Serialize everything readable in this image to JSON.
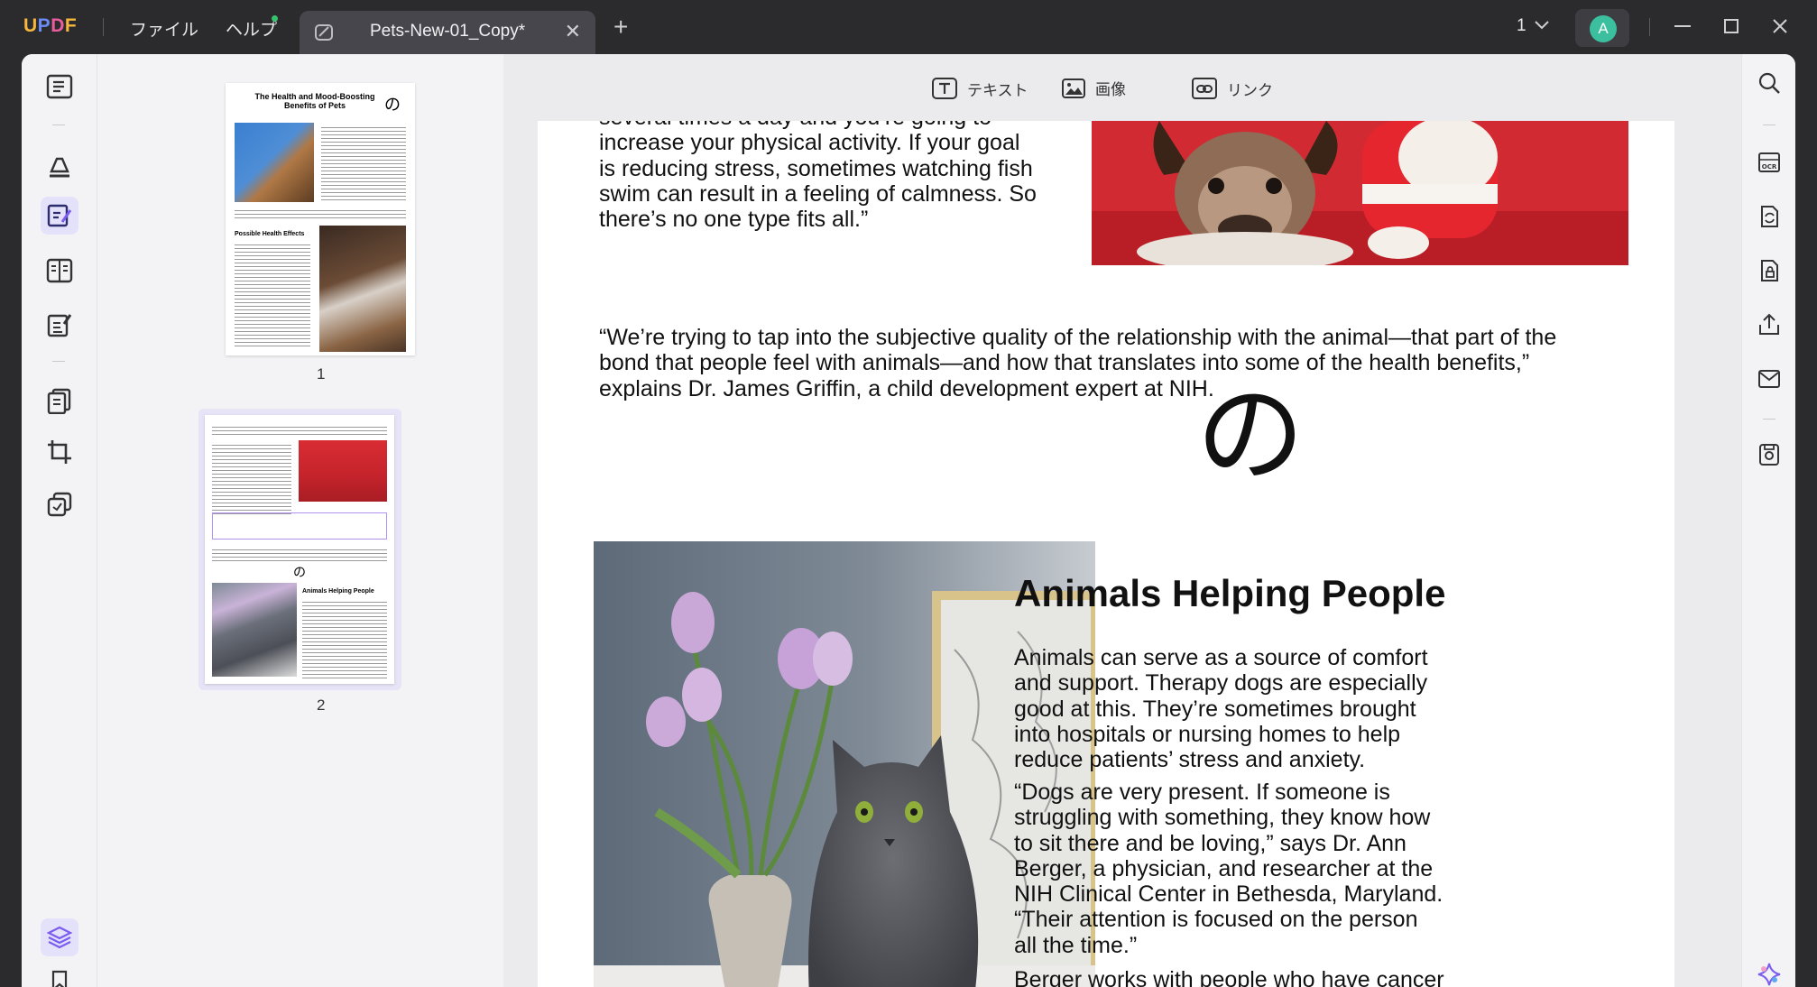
{
  "app": {
    "logo": "UPDF"
  },
  "menu": {
    "file": "ファイル",
    "help": "ヘルプ"
  },
  "tab": {
    "title": "Pets-New-01_Copy*"
  },
  "page_selector": {
    "value": "1"
  },
  "user": {
    "initial": "A"
  },
  "toolbar": {
    "text": "テキスト",
    "image": "画像",
    "link": "リンク"
  },
  "thumbnails": [
    {
      "number": "1",
      "title": "The Health and Mood-Boosting Benefits of Pets",
      "glyph": "の",
      "section": "Possible Health Effects"
    },
    {
      "number": "2",
      "glyph": "の",
      "section": "Animals Helping People"
    }
  ],
  "document": {
    "para1_lines": [
      "several times a day and you’re going to",
      "increase your physical activity.  If your goal",
      "is reducing stress, sometimes watching fish",
      "swim can result in a feeling of calmness. So",
      "there’s no one type fits all.”"
    ],
    "quote_lines": [
      "“We’re trying to tap into the subjective quality of the relationship with the animal—that part of the",
      "bond that people feel with animals—and how that translates into some of the health benefits,”",
      "explains Dr. James Griffin, a child development expert at NIH."
    ],
    "glyph": "の",
    "heading": "Animals Helping People",
    "para2_lines": [
      "Animals can serve as a source of comfort",
      "and support. Therapy dogs are especially",
      "good at this. They’re sometimes brought",
      "into hospitals or nursing homes to help",
      "reduce patients’ stress and anxiety."
    ],
    "para3_lines": [
      "“Dogs are very present. If someone is",
      "struggling with something, they know how",
      "to sit there and be loving,”  says  Dr.  Ann",
      "Berger,  a  physician, and researcher at the",
      "NIH Clinical Center in Bethesda, Maryland.",
      "“Their  attention  is  focused  on  the person",
      "all the time.”"
    ],
    "para4_line": "Berger works with people who have cancer"
  },
  "colors": {
    "accent": "#7b5cf0",
    "titlebar": "#2b2b2e",
    "avatar": "#3bbf9f"
  }
}
